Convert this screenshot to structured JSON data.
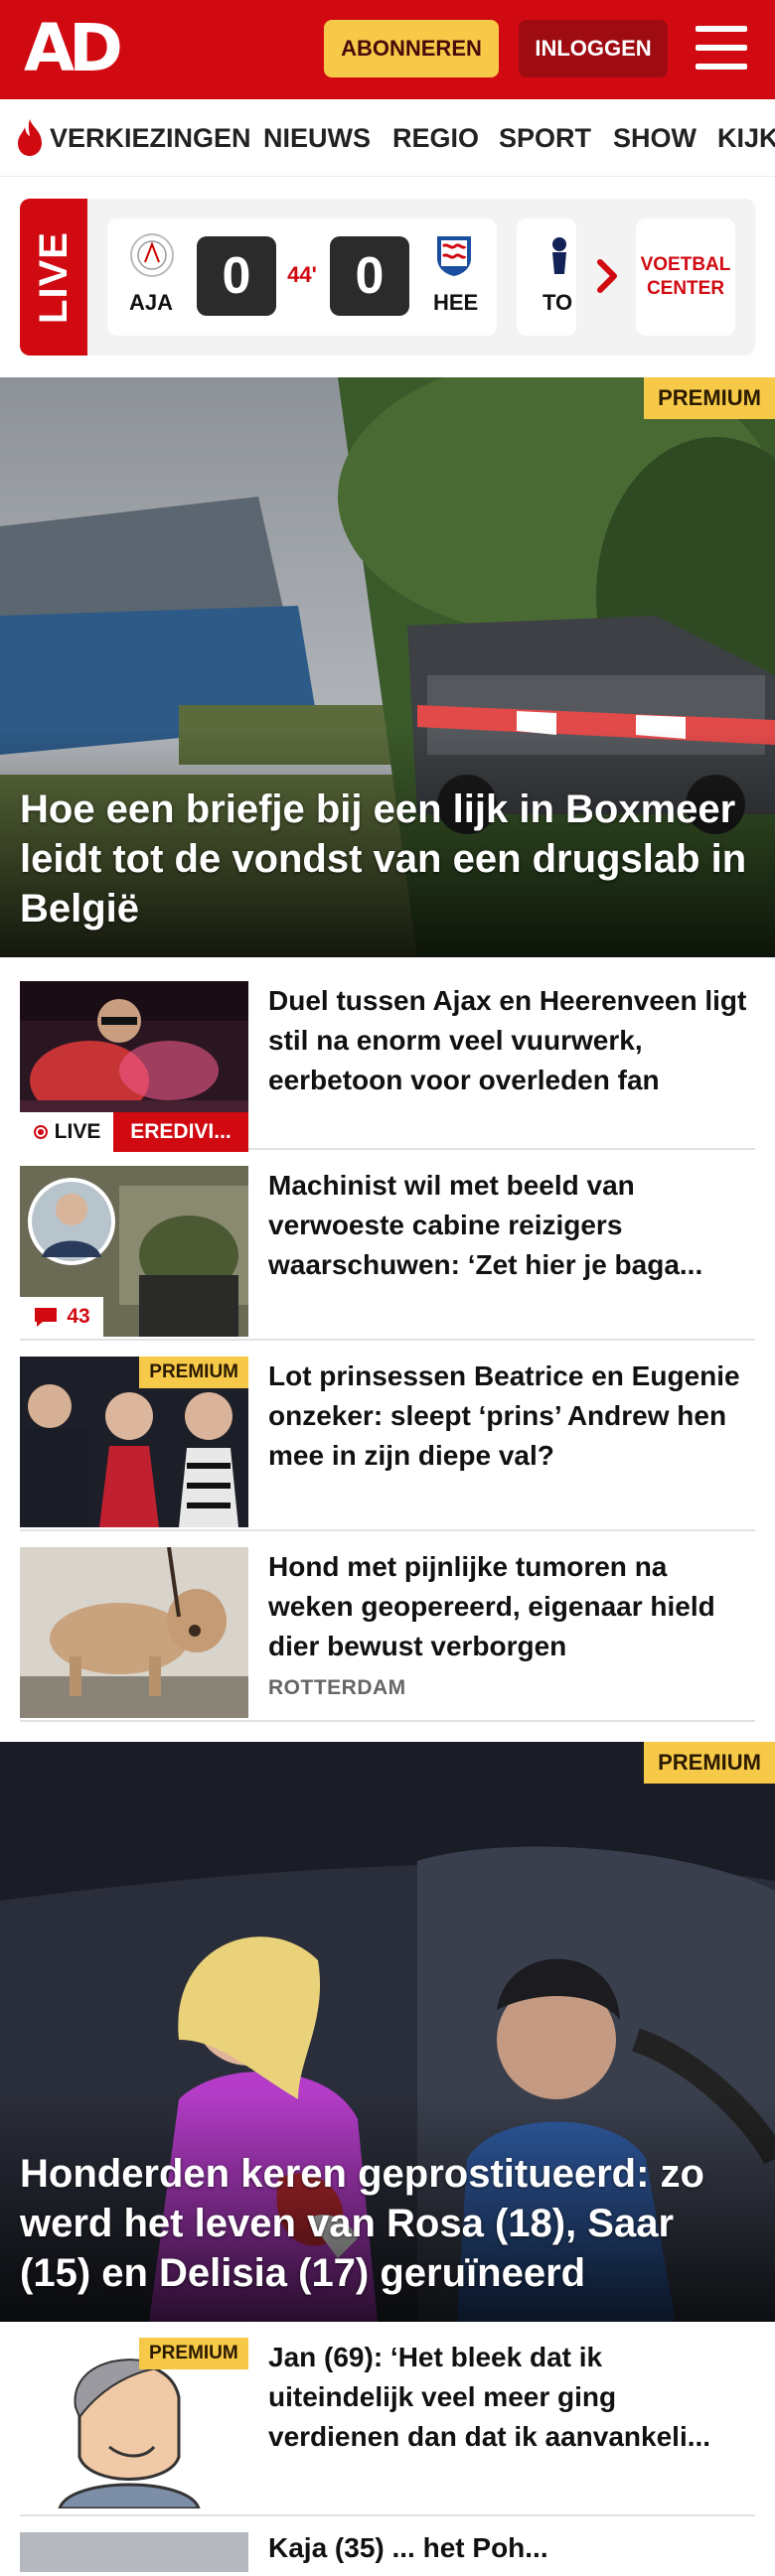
{
  "header": {
    "logo": "AD",
    "subscribe_label": "ABONNEREN",
    "login_label": "INLOGGEN",
    "menu_icon": "hamburger-menu-icon",
    "brand_color": "#d10a11",
    "accent_color": "#f7c948"
  },
  "nav": {
    "items": [
      "VERKIEZINGEN",
      "NIEUWS",
      "REGIO",
      "SPORT",
      "SHOW",
      "KIJK"
    ],
    "featured_icon": "flame-icon"
  },
  "live": {
    "label": "LIVE",
    "match": {
      "home": "AJA",
      "away": "HEE",
      "home_score": "0",
      "away_score": "0",
      "minute": "44'"
    },
    "next_team": "TO",
    "center_label": "VOETBAL CENTER"
  },
  "hero1": {
    "badge": "PREMIUM",
    "title": "Hoe een briefje bij een lijk in Boxmeer leidt tot de vondst van een drugslab in België"
  },
  "articles": [
    {
      "title": "Duel tussen Ajax en Heerenveen ligt stil na enorm veel vuurwerk, eerbetoon voor overleden fan",
      "live_label": "LIVE",
      "category": "EREDIVI..."
    },
    {
      "title": "Machinist wil met beeld van verwoeste cabine reizigers waarschuwen: ‘Zet hier je baga...",
      "comments": "43"
    },
    {
      "title": "Lot prinsessen Beatrice en Eugenie onzeker: sleept ‘prins’ Andrew hen mee in zijn diepe val?",
      "badge": "PREMIUM"
    },
    {
      "title": "Hond met pijnlijke tumoren na weken geopereerd, eigenaar hield dier bewust verborgen",
      "region": "ROTTERDAM"
    }
  ],
  "hero2": {
    "badge": "PREMIUM",
    "title": "Honderden keren geprostitueerd: zo werd het leven van Rosa (18), Saar (15) en Delisia (17) geruïneerd"
  },
  "article5": {
    "badge": "PREMIUM",
    "title": "Jan (69): ‘Het bleek dat ik uiteindelijk veel meer ging verdienen dan dat ik aanvankeli..."
  },
  "article6": {
    "title": "Kaja (35) ... het Poh..."
  }
}
